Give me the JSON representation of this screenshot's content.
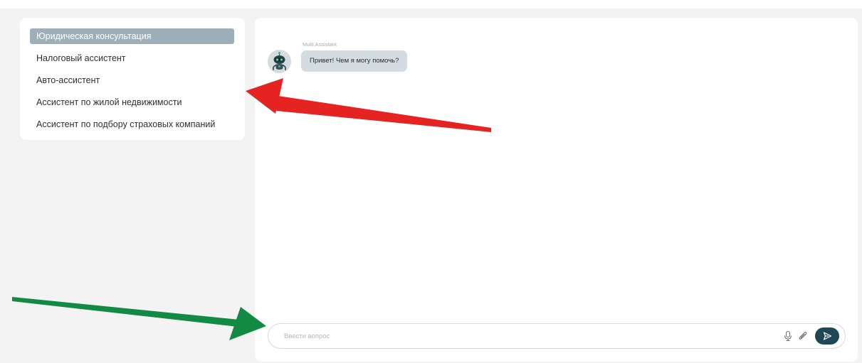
{
  "sidebar": {
    "items": [
      {
        "label": "Юридическая консультация",
        "active": true
      },
      {
        "label": "Налоговый ассистент",
        "active": false
      },
      {
        "label": "Авто-ассистент",
        "active": false
      },
      {
        "label": "Ассистент по жилой недвижимости",
        "active": false
      },
      {
        "label": "Ассистент по подбору страховых компаний",
        "active": false
      }
    ]
  },
  "chat": {
    "messages": [
      {
        "sender": "Multi Assistant",
        "text": "Привет! Чем я могу помочь?",
        "avatar": "robot-avatar"
      }
    ],
    "composer": {
      "placeholder": "Ввести вопрос",
      "value": "",
      "icons": [
        "microphone-icon",
        "paperclip-icon",
        "send-icon"
      ]
    }
  },
  "colors": {
    "page_background": "#f3f3f3",
    "active_item": "#9db0b9",
    "bubble": "#d3dde1",
    "send_button": "#1f4756",
    "arrow_red": "#e52421",
    "arrow_green": "#138a44"
  },
  "annotations": [
    "red-arrow",
    "green-arrow"
  ]
}
